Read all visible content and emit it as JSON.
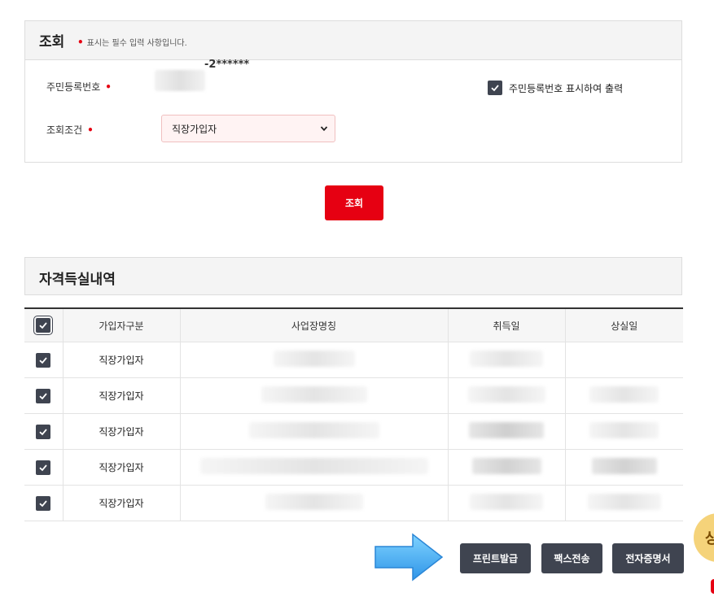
{
  "search_panel": {
    "title": "조회",
    "required_note": "표시는 필수 입력 사항입니다.",
    "rrn_label": "주민등록번호",
    "rrn_suffix": "-2******",
    "show_rrn_label": "주민등록번호 표시하여 출력",
    "show_rrn_checked": true,
    "condition_label": "조회조건",
    "condition_value": "직장가입자",
    "required_mark": "•"
  },
  "search_button": "조회",
  "section": {
    "title": "자격득실내역"
  },
  "table": {
    "headers": [
      "가입자구분",
      "사업장명칭",
      "취득일",
      "상실일"
    ],
    "rows": [
      {
        "type": "직장가입자",
        "checked": true
      },
      {
        "type": "직장가입자",
        "checked": true
      },
      {
        "type": "직장가입자",
        "checked": true
      },
      {
        "type": "직장가입자",
        "checked": true
      },
      {
        "type": "직장가입자",
        "checked": true
      }
    ]
  },
  "actions": {
    "print": "프린트발급",
    "fax": "팩스전송",
    "ecert": "전자증명서"
  },
  "colors": {
    "accent": "#e60012",
    "dark_button": "#3f4450",
    "arrow": "#3aa8f0"
  },
  "icons": {
    "checkbox": "checkmark-icon",
    "select": "chevron-down-icon",
    "arrow": "right-arrow-icon"
  }
}
